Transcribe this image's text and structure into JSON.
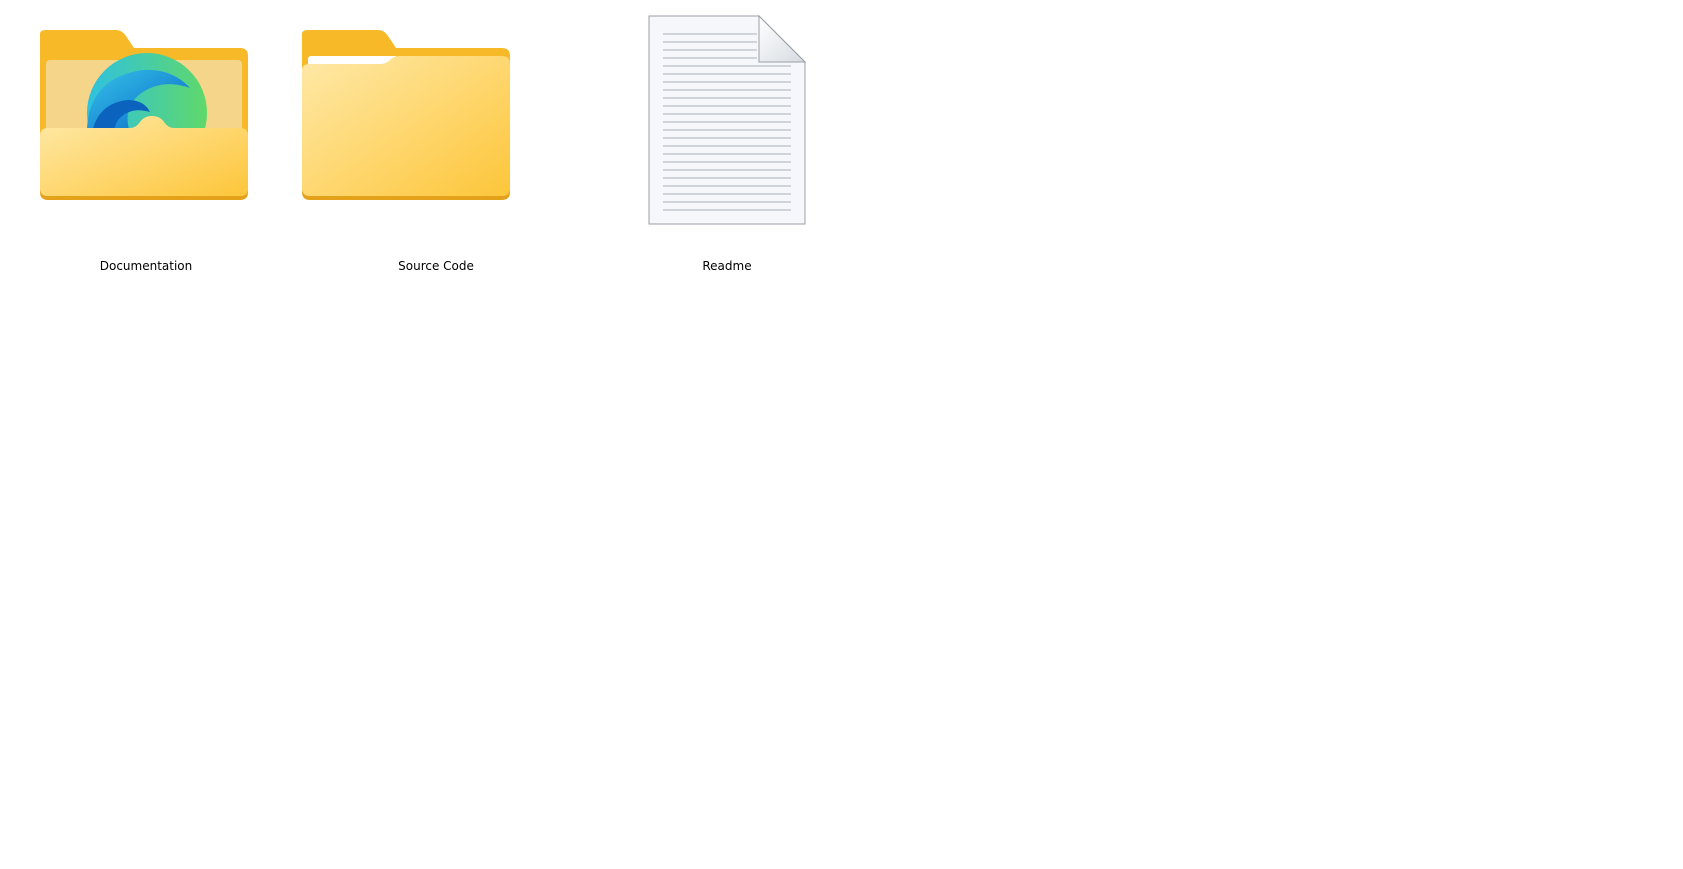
{
  "desktop": {
    "items": [
      {
        "label": "Documentation",
        "icon": "folder-with-edge-icon",
        "type": "folder"
      },
      {
        "label": "Source Code",
        "icon": "folder-with-documents-icon",
        "type": "folder"
      },
      {
        "label": "Readme",
        "icon": "text-document-icon",
        "type": "text-file"
      }
    ]
  },
  "colors": {
    "folder_back": "#F7B927",
    "folder_front_light": "#FFE7A3",
    "folder_front_dark": "#FDC942",
    "folder_edge": "#E3A21A",
    "document_paper": "#F5F7FA",
    "document_line": "#9AA3AD"
  }
}
